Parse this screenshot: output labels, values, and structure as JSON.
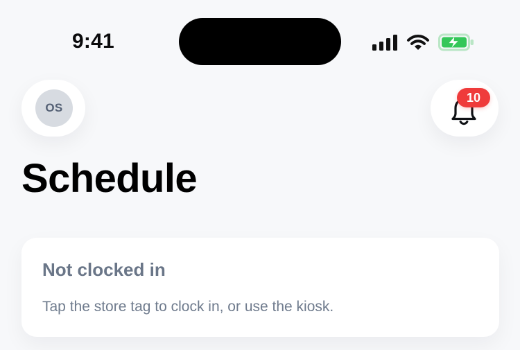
{
  "status_bar": {
    "time": "9:41",
    "signal_icon": "signal-icon",
    "wifi_icon": "wifi-icon",
    "battery_icon": "battery-charging-icon",
    "battery_color": "#34C759"
  },
  "header": {
    "avatar_initials": "OS",
    "notification_icon": "bell-icon",
    "notification_count": "10",
    "badge_color": "#EF3B3B"
  },
  "page": {
    "title": "Schedule"
  },
  "clock_card": {
    "title": "Not clocked in",
    "subtitle": "Tap the store tag to clock in, or use the kiosk."
  }
}
